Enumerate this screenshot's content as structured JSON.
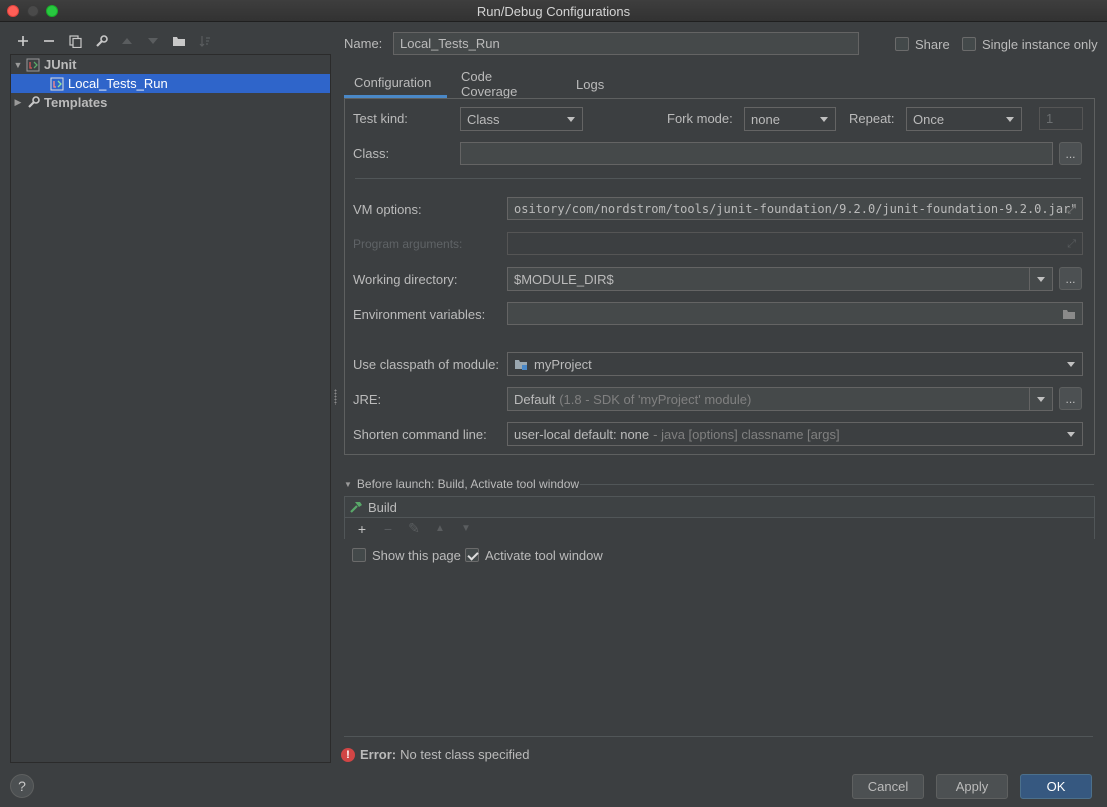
{
  "window": {
    "title": "Run/Debug Configurations"
  },
  "left_toolbar": {
    "items": [
      {
        "icon": "add-icon"
      },
      {
        "icon": "remove-icon"
      },
      {
        "icon": "copy-icon"
      },
      {
        "icon": "wrench-icon"
      },
      {
        "icon": "move-up-icon"
      },
      {
        "icon": "move-down-icon"
      },
      {
        "icon": "folder-icon"
      },
      {
        "icon": "sort-icon"
      }
    ]
  },
  "tree": {
    "group_label": "JUnit",
    "config_label": "Local_Tests_Run",
    "templates_label": "Templates"
  },
  "header": {
    "name_label": "Name:",
    "name_value": "Local_Tests_Run",
    "share_label": "Share",
    "single_instance_label": "Single instance only"
  },
  "tabs": [
    "Configuration",
    "Code Coverage",
    "Logs"
  ],
  "form": {
    "test_kind_label": "Test kind:",
    "test_kind_value": "Class",
    "fork_mode_label": "Fork mode:",
    "fork_mode_value": "none",
    "repeat_label": "Repeat:",
    "repeat_value": "Once",
    "repeat_count": "1",
    "class_label": "Class:",
    "class_value": "",
    "vm_options_label": "VM options:",
    "vm_options_value": "ository/com/nordstrom/tools/junit-foundation/9.2.0/junit-foundation-9.2.0.jar\"",
    "program_args_label": "Program arguments:",
    "program_args_value": "",
    "working_dir_label": "Working directory:",
    "working_dir_value": "$MODULE_DIR$",
    "env_vars_label": "Environment variables:",
    "env_vars_value": "",
    "classpath_label": "Use classpath of module:",
    "classpath_value": "myProject",
    "jre_label": "JRE:",
    "jre_value": "Default",
    "jre_detail": "(1.8 - SDK of 'myProject' module)",
    "shorten_label": "Shorten command line:",
    "shorten_value": "user-local default: none",
    "shorten_detail": "- java [options] classname [args]",
    "browse_label": "..."
  },
  "before_launch": {
    "title": "Before launch: Build, Activate tool window",
    "task": "Build",
    "show_page_label": "Show this page",
    "activate_label": "Activate tool window"
  },
  "error": {
    "prefix": "Error:",
    "message": "No test class specified"
  },
  "buttons": {
    "help": "?",
    "cancel": "Cancel",
    "apply": "Apply",
    "ok": "OK"
  },
  "colors": {
    "selection": "#2f65ca",
    "primary": "#365880",
    "error": "#d14545"
  }
}
